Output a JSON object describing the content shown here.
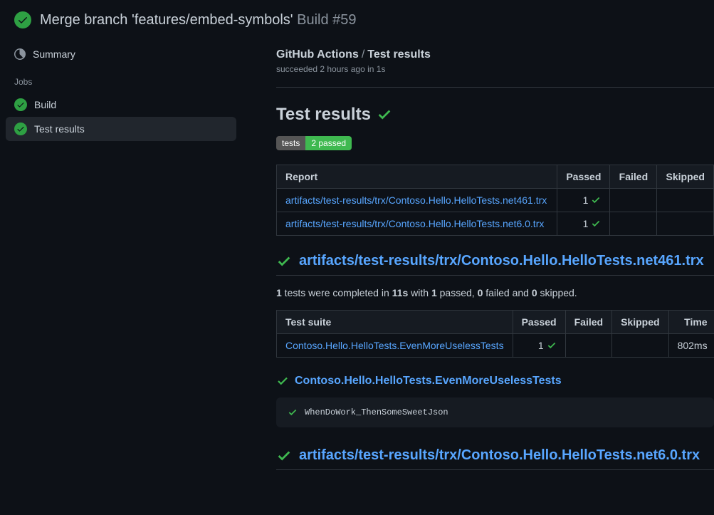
{
  "header": {
    "title_prefix": "Merge branch 'features/embed-symbols'",
    "build_label": "Build #59"
  },
  "sidebar": {
    "summary_label": "Summary",
    "jobs_label": "Jobs",
    "items": [
      {
        "label": "Build"
      },
      {
        "label": "Test results"
      }
    ]
  },
  "main": {
    "crumb_parent": "GitHub Actions",
    "crumb_child": "Test results",
    "status_line": "succeeded 2 hours ago in 1s",
    "h2": "Test results",
    "badge_left": "tests",
    "badge_right": "2 passed",
    "report_table": {
      "headers": [
        "Report",
        "Passed",
        "Failed",
        "Skipped"
      ],
      "rows": [
        {
          "report": "artifacts/test-results/trx/Contoso.Hello.HelloTests.net461.trx",
          "passed": "1",
          "failed": "",
          "skipped": ""
        },
        {
          "report": "artifacts/test-results/trx/Contoso.Hello.HelloTests.net6.0.trx",
          "passed": "1",
          "failed": "",
          "skipped": ""
        }
      ]
    },
    "section1": {
      "title": "artifacts/test-results/trx/Contoso.Hello.HelloTests.net461.trx",
      "desc_parts": {
        "count": "1",
        "t1": " tests were completed in ",
        "time": "11s",
        "t2": " with ",
        "passed": "1",
        "t3": " passed, ",
        "failed": "0",
        "t4": " failed and ",
        "skipped": "0",
        "t5": " skipped."
      },
      "suite_table": {
        "headers": [
          "Test suite",
          "Passed",
          "Failed",
          "Skipped",
          "Time"
        ],
        "rows": [
          {
            "suite": "Contoso.Hello.HelloTests.EvenMoreUselessTests",
            "passed": "1",
            "failed": "",
            "skipped": "",
            "time": "802ms"
          }
        ]
      },
      "sub_title": "Contoso.Hello.HelloTests.EvenMoreUselessTests",
      "test_name": "WhenDoWork_ThenSomeSweetJson"
    },
    "section2": {
      "title": "artifacts/test-results/trx/Contoso.Hello.HelloTests.net6.0.trx"
    }
  }
}
